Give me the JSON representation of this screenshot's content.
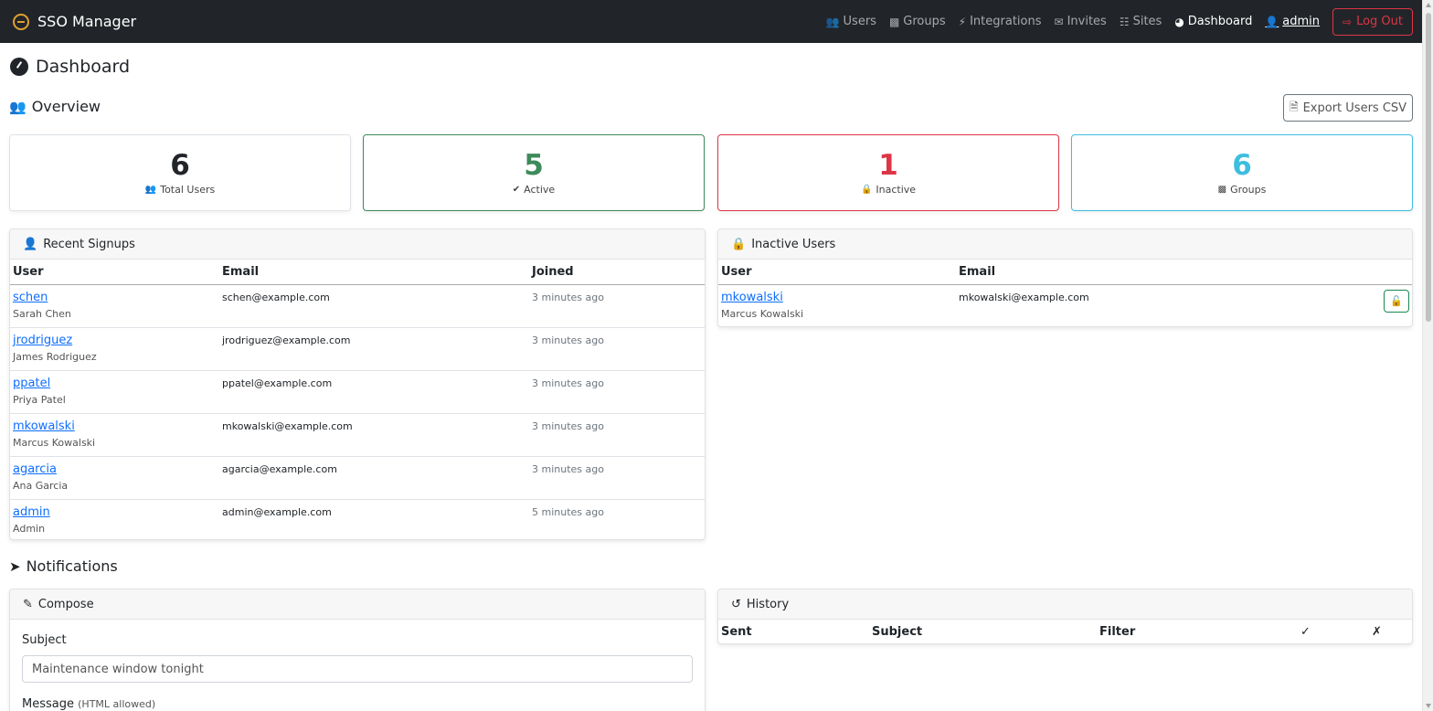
{
  "navbar": {
    "brand": "SSO Manager",
    "links": [
      {
        "label": "Users",
        "icon": "users-icon"
      },
      {
        "label": "Groups",
        "icon": "groups-icon"
      },
      {
        "label": "Integrations",
        "icon": "plug-icon"
      },
      {
        "label": "Invites",
        "icon": "envelope-icon"
      },
      {
        "label": "Sites",
        "icon": "sitemap-icon"
      },
      {
        "label": "Dashboard",
        "icon": "gauge-icon",
        "active": true
      }
    ],
    "user": "admin",
    "logout": "Log Out"
  },
  "page": {
    "title": "Dashboard"
  },
  "overview": {
    "title": "Overview",
    "export_label": "Export Users CSV",
    "stats": [
      {
        "value": "6",
        "label": "Total Users",
        "color": "#212529"
      },
      {
        "value": "5",
        "label": "Active",
        "color": "#3d8a5a"
      },
      {
        "value": "1",
        "label": "Inactive",
        "color": "#dc3545"
      },
      {
        "value": "6",
        "label": "Groups",
        "color": "#3dbde0"
      }
    ]
  },
  "recent_signups": {
    "title": "Recent Signups",
    "columns": [
      "User",
      "Email",
      "Joined"
    ],
    "rows": [
      {
        "username": "schen",
        "name": "Sarah Chen",
        "email": "schen@example.com",
        "joined": "3 minutes ago"
      },
      {
        "username": "jrodriguez",
        "name": "James Rodriguez",
        "email": "jrodriguez@example.com",
        "joined": "3 minutes ago"
      },
      {
        "username": "ppatel",
        "name": "Priya Patel",
        "email": "ppatel@example.com",
        "joined": "3 minutes ago"
      },
      {
        "username": "mkowalski",
        "name": "Marcus Kowalski",
        "email": "mkowalski@example.com",
        "joined": "3 minutes ago"
      },
      {
        "username": "agarcia",
        "name": "Ana Garcia",
        "email": "agarcia@example.com",
        "joined": "3 minutes ago"
      },
      {
        "username": "admin",
        "name": "Admin",
        "email": "admin@example.com",
        "joined": "5 minutes ago"
      }
    ]
  },
  "inactive_users": {
    "title": "Inactive Users",
    "columns": [
      "User",
      "Email"
    ],
    "rows": [
      {
        "username": "mkowalski",
        "name": "Marcus Kowalski",
        "email": "mkowalski@example.com"
      }
    ]
  },
  "notifications": {
    "title": "Notifications",
    "compose": {
      "title": "Compose",
      "subject_label": "Subject",
      "subject_value": "Maintenance window tonight",
      "message_label": "Message",
      "message_hint": "(HTML allowed)"
    },
    "history": {
      "title": "History",
      "columns": [
        "Sent",
        "Subject",
        "Filter",
        "✓",
        "✗"
      ]
    }
  }
}
